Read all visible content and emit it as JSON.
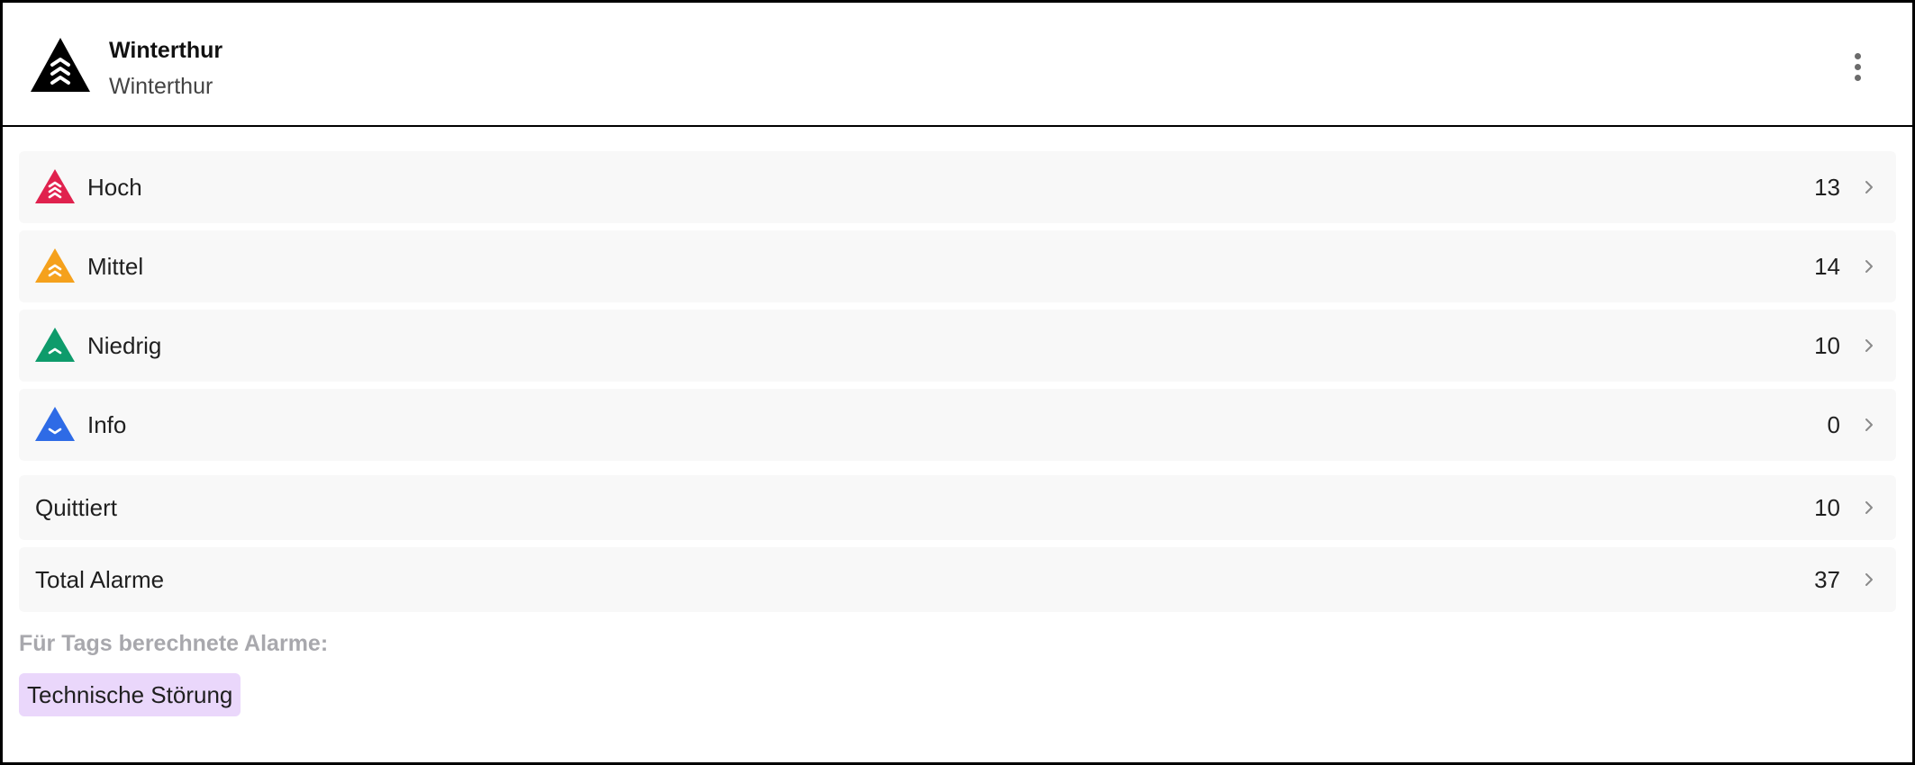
{
  "header": {
    "title": "Winterthur",
    "subtitle": "Winterthur",
    "logo_icon": "triple-chevron-triangle-icon",
    "menu_icon": "more-vertical-icon"
  },
  "severities": [
    {
      "label": "Hoch",
      "count": "13",
      "color": "#e0224e",
      "icon": "triple-chevron-up-triangle-icon"
    },
    {
      "label": "Mittel",
      "count": "14",
      "color": "#f5a11c",
      "icon": "double-chevron-up-triangle-icon"
    },
    {
      "label": "Niedrig",
      "count": "10",
      "color": "#0e9b6b",
      "icon": "single-chevron-up-triangle-icon"
    },
    {
      "label": "Info",
      "count": "0",
      "color": "#2e6be6",
      "icon": "chevron-down-triangle-icon"
    }
  ],
  "summary": [
    {
      "label": "Quittiert",
      "count": "10"
    },
    {
      "label": "Total Alarme",
      "count": "37"
    }
  ],
  "tags": {
    "heading": "Für Tags berechnete Alarme:",
    "items": [
      "Technische Störung"
    ],
    "chip_color": "#ead7fb"
  }
}
